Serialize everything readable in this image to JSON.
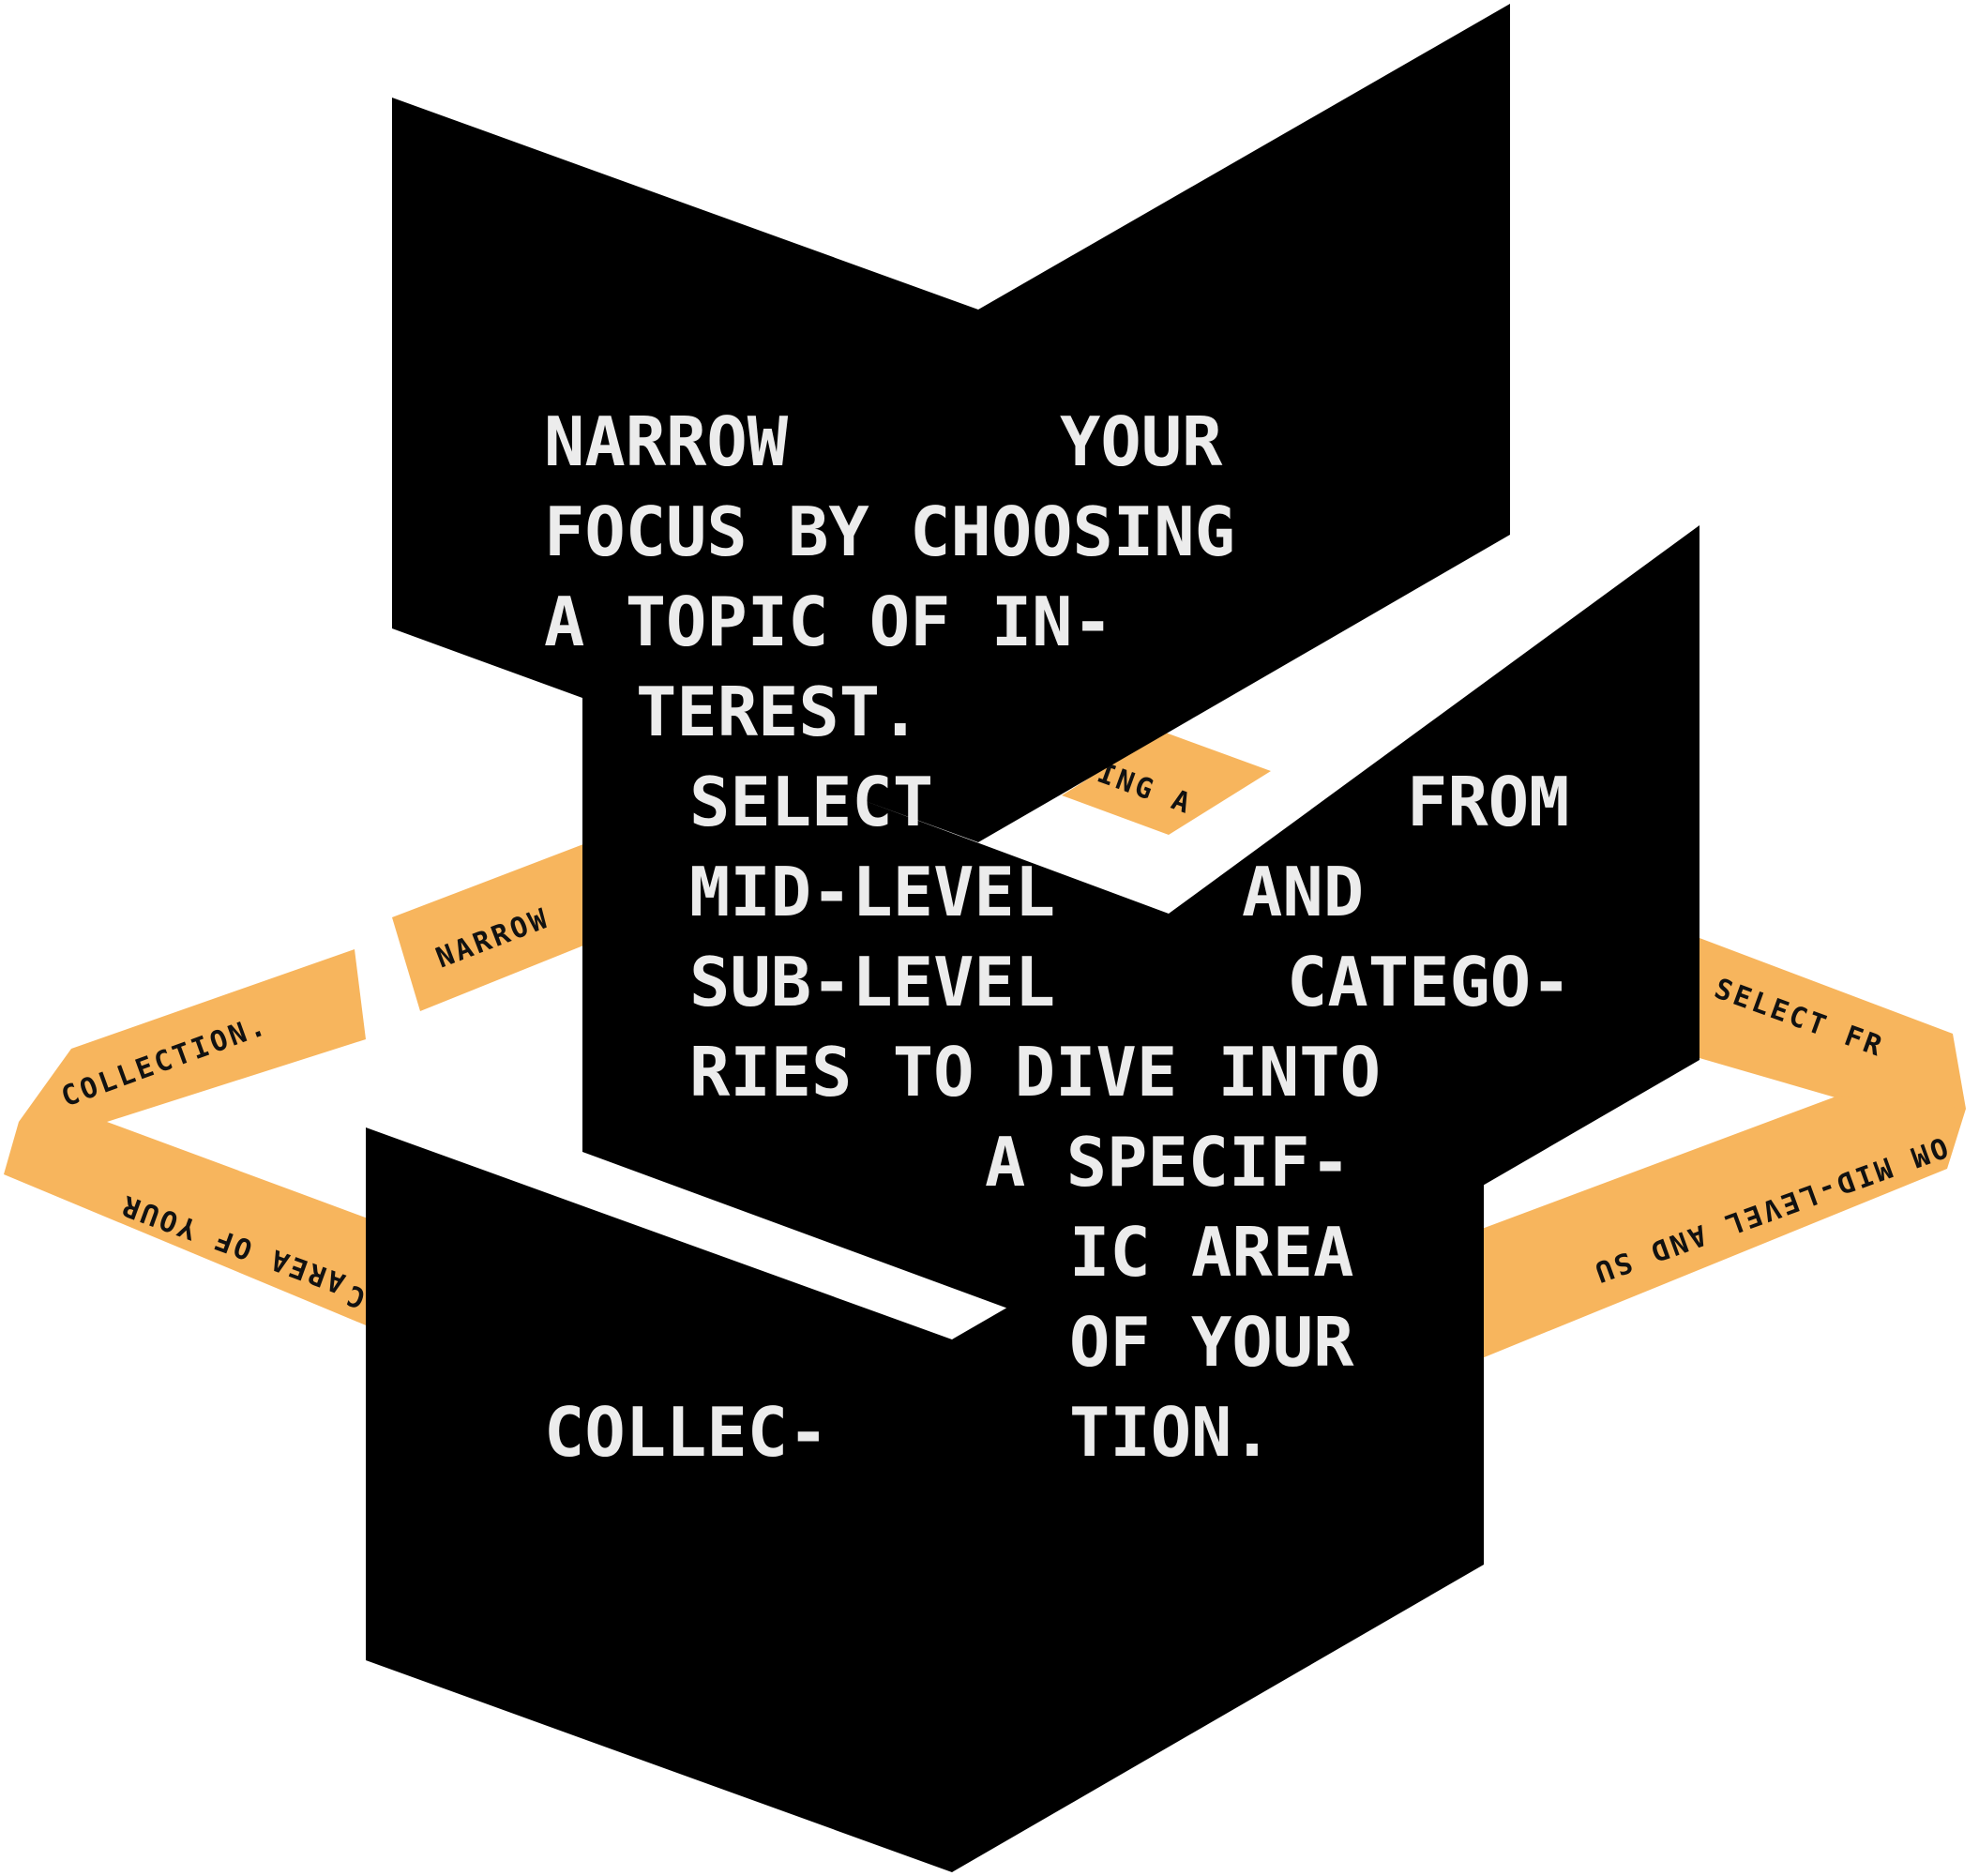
{
  "colors": {
    "background": "#ffffff",
    "chevron": "#000000",
    "tape": "#f7b55d",
    "tape_text": "#111111",
    "main_text": "#ececec"
  },
  "tape": {
    "narrow": "NARROW",
    "ing_a": "ING A",
    "collection": "COLLECTION.",
    "area_of_your": "AREA OF YOUR",
    "area_of_your_tail": "C",
    "select_fr": "SELECT FR",
    "mid_level_and_su": "OM MID-LEVEL AND SU"
  },
  "main": {
    "line_1a": "NARROW",
    "line_1b": "YOUR",
    "line_2": "FOCUS BY CHOOSING",
    "line_3": "A TOPIC OF IN-",
    "line_4": "TEREST.",
    "line_5a": "SELECT",
    "line_5b": "FROM",
    "line_6a": "MID-LEVEL",
    "line_6b": "AND",
    "line_7a": "SUB-LEVEL",
    "line_7b": "CATEGO-",
    "line_8": "RIES TO DIVE INTO",
    "line_9": "A SPECIF-",
    "line_10": "IC AREA",
    "line_11": "OF YOUR",
    "line_12a": "COLLEC-",
    "line_12b": "TION."
  }
}
